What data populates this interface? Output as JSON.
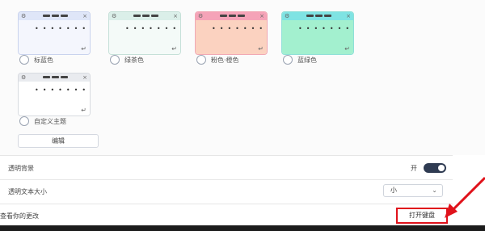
{
  "themes": [
    {
      "label": "标蓝色",
      "colors": {
        "bar": "#dfe6f8",
        "body": "#f4f6fd",
        "border": "#c9d3ee"
      }
    },
    {
      "label": "绿茶色",
      "colors": {
        "bar": "#dbefe9",
        "body": "#f4faf8",
        "border": "#c5e0d8"
      }
    },
    {
      "label": "粉色·橙色",
      "colors": {
        "bar": "#f5a3b8",
        "body": "#fbd2c0",
        "border": "#f1a8b4"
      }
    },
    {
      "label": "蓝绿色",
      "colors": {
        "bar": "#7fe3e3",
        "body": "#a3f0cf",
        "border": "#8fe0d8"
      }
    },
    {
      "label": "自定义主题",
      "colors": {
        "bar": "#e9ebef",
        "body": "#ffffff",
        "border": "#d8dbe0"
      }
    }
  ],
  "card_glyphs": {
    "gear": "⚙",
    "close": "×",
    "dots": "••••••••",
    "enter": "↵"
  },
  "edit_button": "编辑",
  "settings": {
    "transparent_background": {
      "label": "透明背景",
      "state_text": "开"
    },
    "text_size": {
      "label": "透明文本大小",
      "value": "小"
    },
    "open_keyboard": {
      "label": "查看你的更改",
      "button": "打开键盘"
    }
  },
  "colors": {
    "toggle_on": "#2f3b52",
    "highlight": "#e0121b"
  }
}
